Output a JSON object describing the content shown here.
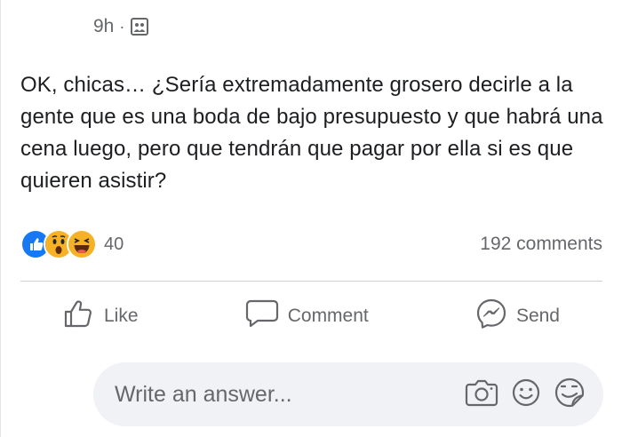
{
  "post": {
    "time": "9h",
    "separator": "·",
    "audience_icon": "group-icon",
    "text": "OK, chicas… ¿Sería extremadamente grosero decirle a la gente que es una boda de bajo presupuesto y que habrá una cena luego, pero que tendrán que pagar por ella si es que quieren asistir?"
  },
  "reactions": {
    "icons": [
      "like-reaction-icon",
      "wow-reaction-icon",
      "haha-reaction-icon"
    ],
    "count": "40",
    "comments": "192 comments"
  },
  "actions": {
    "like": "Like",
    "comment": "Comment",
    "send": "Send"
  },
  "composer": {
    "placeholder": "Write an answer...",
    "icons": [
      "camera-icon",
      "emoji-icon",
      "sticker-icon"
    ]
  },
  "colors": {
    "secondary_text": "#65676b",
    "like_blue": "#1877f2",
    "reaction_yellow": "#f7b125",
    "input_bg": "#f0f2f5"
  }
}
